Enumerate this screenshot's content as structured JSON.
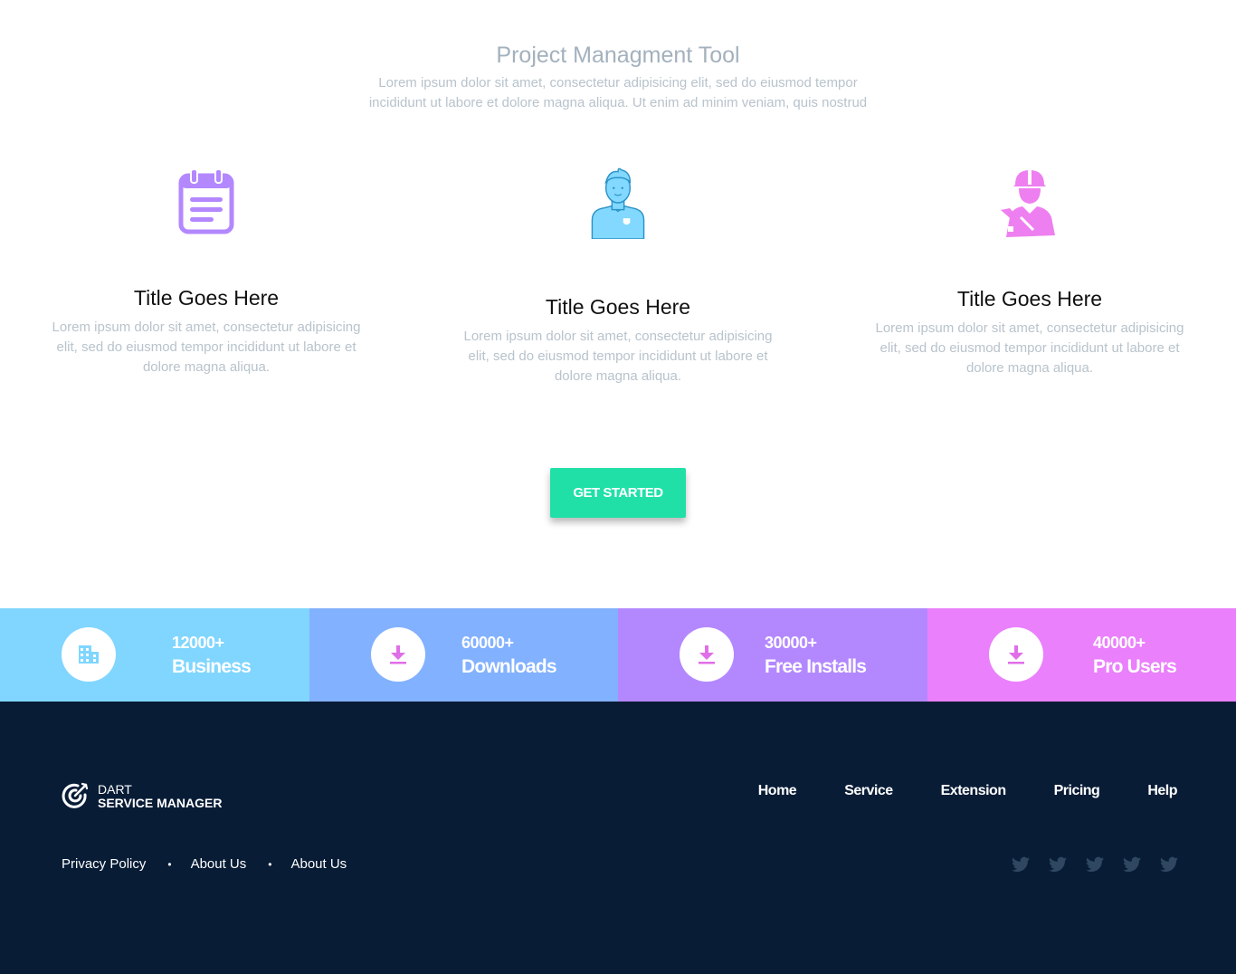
{
  "intro": {
    "title": "Project Managment Tool",
    "text": "Lorem ipsum dolor sit amet, consectetur adipisicing elit, sed do eiusmod tempor incididunt ut labore et dolore magna aliqua. Ut enim ad minim veniam, quis nostrud"
  },
  "features": [
    {
      "icon": "calendar-icon",
      "color": "#b388ff",
      "title": "Title Goes Here",
      "text": "Lorem ipsum dolor sit amet, consectetur adipisicing elit, sed do eiusmod tempor incididunt ut labore et dolore magna aliqua."
    },
    {
      "icon": "person-icon",
      "color": "#82d8ff",
      "title": "Title Goes Here",
      "text": "Lorem ipsum dolor sit amet, consectetur adipisicing elit, sed do eiusmod tempor incididunt ut labore et dolore magna aliqua."
    },
    {
      "icon": "worker-icon",
      "color": "#ee7ff0",
      "title": "Title Goes Here",
      "text": "Lorem ipsum dolor sit amet, consectetur adipisicing elit, sed do eiusmod tempor incididunt ut labore et dolore magna aliqua."
    }
  ],
  "cta": {
    "label": "GET STARTED",
    "color": "#20e0a8"
  },
  "stats": [
    {
      "value": "12000+",
      "label": "Business",
      "icon": "building-icon",
      "bg": "#80d6ff",
      "icon_color": "#80d6ff"
    },
    {
      "value": "60000+",
      "label": "Downloads",
      "icon": "download-icon",
      "bg": "#82b1ff",
      "icon_color": "#e06ee8"
    },
    {
      "value": "30000+",
      "label": "Free Installs",
      "icon": "download-icon",
      "bg": "#b388ff",
      "icon_color": "#e06ee8"
    },
    {
      "value": "40000+",
      "label": "Pro Users",
      "icon": "download-icon",
      "bg": "#ea80fc",
      "icon_color": "#e06ee8"
    }
  ],
  "footer": {
    "bg": "#081c36",
    "logo_line1": "DART",
    "logo_line2": "SERVICE MANAGER",
    "nav": [
      "Home",
      "Service",
      "Extension",
      "Pricing",
      "Help"
    ],
    "legal": [
      "Privacy Policy",
      "About Us",
      "About Us"
    ],
    "legal_separator": "•",
    "social": [
      "twitter-icon",
      "twitter-icon",
      "twitter-icon",
      "twitter-icon",
      "twitter-icon"
    ],
    "social_color": "#2f4760"
  }
}
